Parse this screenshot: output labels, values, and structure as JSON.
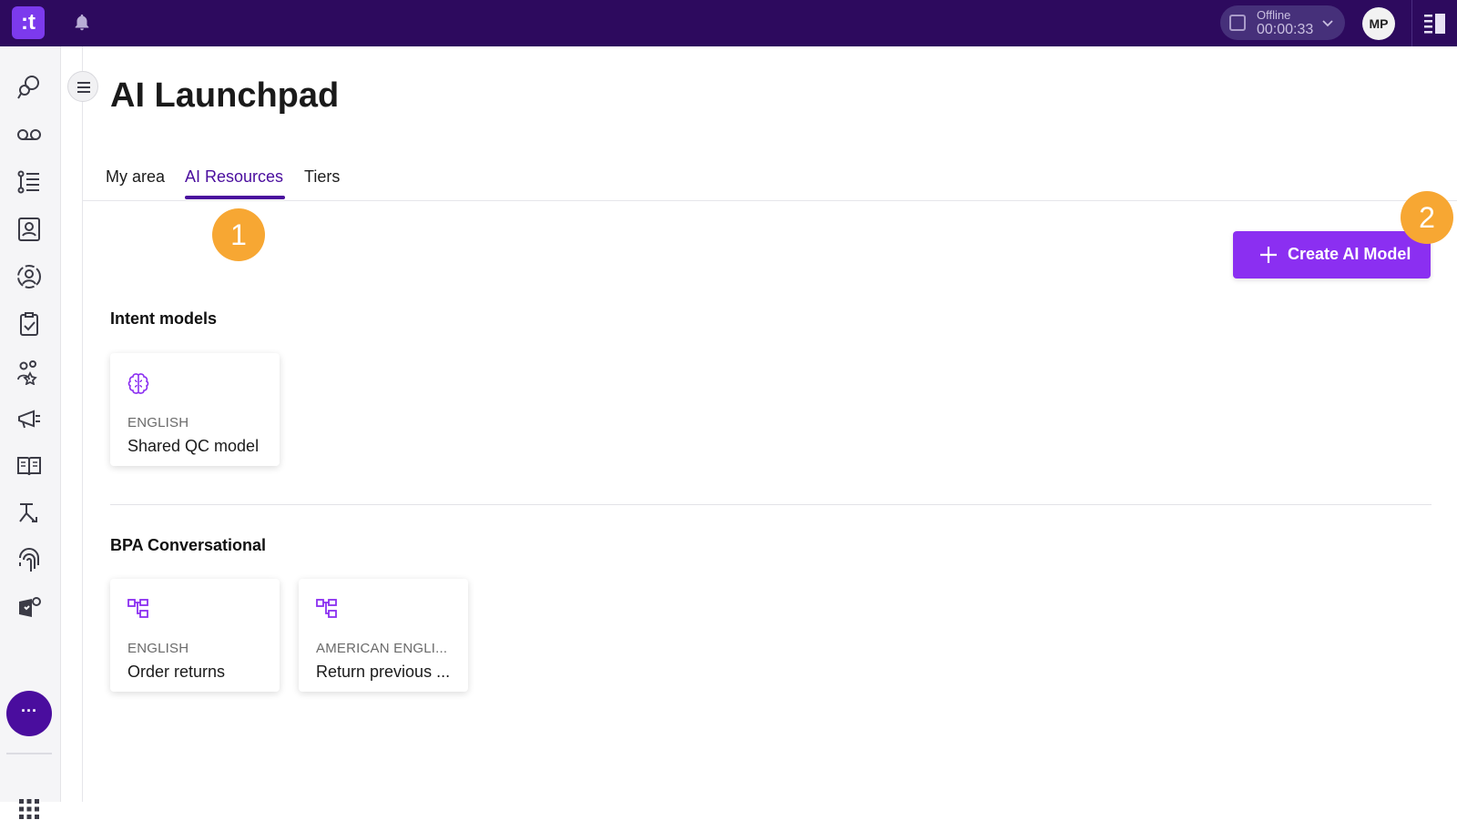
{
  "app": {
    "logo_text": ":t",
    "status": {
      "label": "Offline",
      "timer": "00:00:33"
    },
    "avatar_initials": "MP",
    "nav_more_label": "···"
  },
  "page": {
    "title": "AI Launchpad",
    "tabs": [
      {
        "label": "My area",
        "active": false
      },
      {
        "label": "AI Resources",
        "active": true
      },
      {
        "label": "Tiers",
        "active": false
      }
    ],
    "callouts": [
      "1",
      "2"
    ],
    "create_button_label": "Create AI Model"
  },
  "sections": [
    {
      "title": "Intent models",
      "cards": [
        {
          "icon": "brain-icon",
          "language": "ENGLISH",
          "name": "Shared QC model"
        }
      ]
    },
    {
      "title": "BPA Conversational",
      "cards": [
        {
          "icon": "flow-icon",
          "language": "ENGLISH",
          "name": "Order returns"
        },
        {
          "icon": "flow-icon",
          "language": "AMERICAN ENGLI...",
          "name": "Return previous ..."
        }
      ]
    }
  ],
  "colors": {
    "topbar": "#2d0a5e",
    "accent": "#4a0d9e",
    "button": "#8b2ff1",
    "callout": "#f7a733",
    "icon_purple": "#8b2ff1"
  }
}
